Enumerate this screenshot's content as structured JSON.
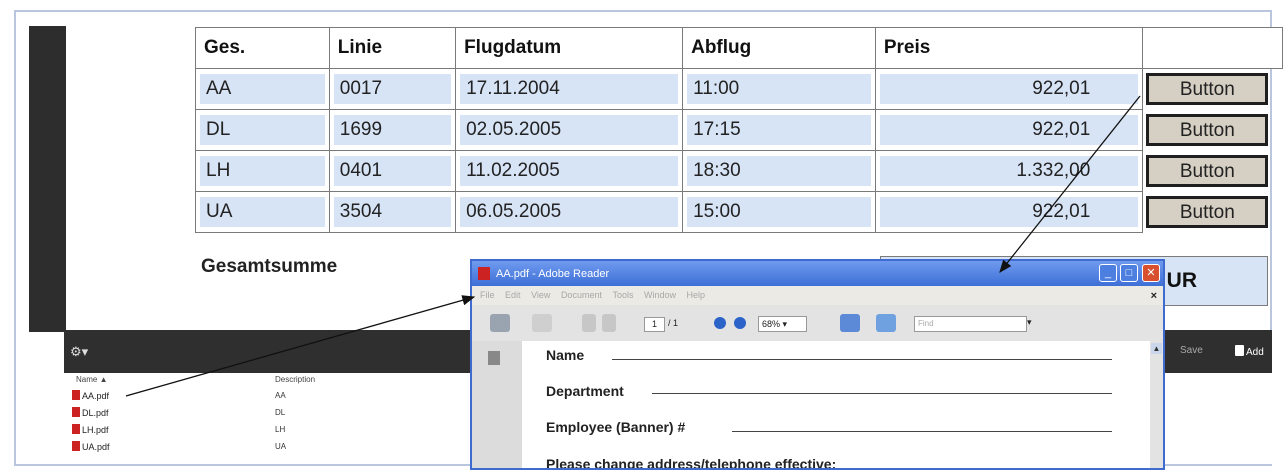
{
  "table": {
    "headers": [
      "Ges.",
      "Linie",
      "Flugdatum",
      "Abflug",
      "Preis"
    ],
    "rows": [
      {
        "ges": "AA",
        "linie": "0017",
        "datum": "17.11.2004",
        "abflug": "11:00",
        "preis": "922,01",
        "button": "Button"
      },
      {
        "ges": "DL",
        "linie": "1699",
        "datum": "02.05.2005",
        "abflug": "17:15",
        "preis": "922,01",
        "button": "Button"
      },
      {
        "ges": "LH",
        "linie": "0401",
        "datum": "11.02.2005",
        "abflug": "18:30",
        "preis": "1.332,00",
        "button": "Button"
      },
      {
        "ges": "UA",
        "linie": "3504",
        "datum": "06.05.2005",
        "abflug": "15:00",
        "preis": "922,01",
        "button": "Button"
      }
    ]
  },
  "total": {
    "label": "Gesamtsumme",
    "value_partial": "UR"
  },
  "file_panel": {
    "col_name": "Name",
    "col_description": "Description",
    "save": "Save",
    "add": "Add",
    "files": [
      {
        "name": "AA.pdf",
        "desc": "AA"
      },
      {
        "name": "DL.pdf",
        "desc": "DL"
      },
      {
        "name": "LH.pdf",
        "desc": "LH"
      },
      {
        "name": "UA.pdf",
        "desc": "UA"
      }
    ]
  },
  "reader": {
    "title": "AA.pdf - Adobe Reader",
    "menu": [
      "File",
      "Edit",
      "View",
      "Document",
      "Tools",
      "Window",
      "Help"
    ],
    "page_current": "1",
    "page_total": "/ 1",
    "zoom": "68%",
    "find_placeholder": "Find",
    "form_labels": [
      "Name",
      "Department",
      "Employee (Banner) #",
      "Please change address/telephone effective:"
    ]
  }
}
